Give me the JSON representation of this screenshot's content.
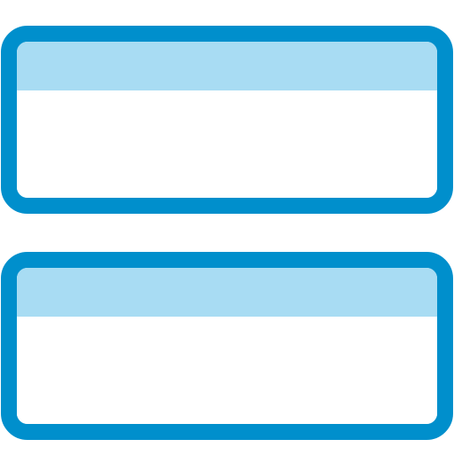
{
  "icon": {
    "name": "two-stacked-panels-icon",
    "colors": {
      "outline": "#008fcc",
      "header_fill": "#a8dcf3",
      "body_fill": "#ffffff",
      "background": "#ffffff"
    },
    "panels": [
      {
        "name": "top-panel"
      },
      {
        "name": "bottom-panel"
      }
    ]
  }
}
